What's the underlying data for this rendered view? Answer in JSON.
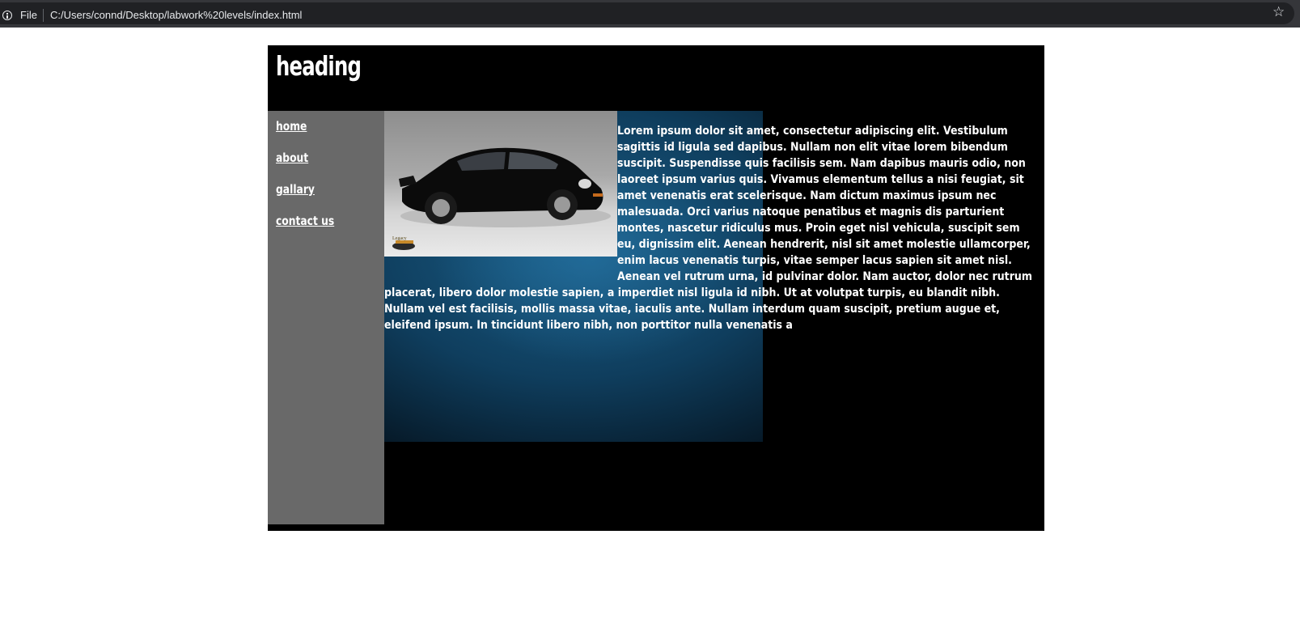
{
  "browser": {
    "file_label": "File",
    "url": "C:/Users/connd/Desktop/labwork%20levels/index.html"
  },
  "page": {
    "heading": "heading",
    "nav": [
      {
        "label": "home"
      },
      {
        "label": "about"
      },
      {
        "label": "gallary"
      },
      {
        "label": "contact us"
      }
    ],
    "car_logo_text": "Legacy",
    "body_text": "Lorem ipsum dolor sit amet, consectetur adipiscing elit. Vestibulum sagittis id ligula sed dapibus. Nullam non elit vitae lorem bibendum suscipit. Suspendisse quis facilisis sem. Nam dapibus mauris odio, non laoreet ipsum varius quis. Vivamus elementum tellus a nisi feugiat, sit amet venenatis erat scelerisque. Nam dictum maximus ipsum nec malesuada. Orci varius natoque penatibus et magnis dis parturient montes, nascetur ridiculus mus. Proin eget nisl vehicula, suscipit sem eu, dignissim elit. Aenean hendrerit, nisl sit amet molestie ullamcorper, enim lacus venenatis turpis, vitae semper lacus sapien sit amet nisl. Aenean vel rutrum urna, id pulvinar dolor. Nam auctor, dolor nec rutrum placerat, libero dolor molestie sapien, a imperdiet nisl ligula id nibh. Ut at volutpat turpis, eu blandit nibh. Nullam vel est facilisis, mollis massa vitae, iaculis ante. Nullam interdum quam suscipit, pretium augue et, eleifend ipsum. In tincidunt libero nibh, non porttitor nulla venenatis a"
  },
  "icons": {
    "info": "info-icon",
    "star": "star-icon"
  },
  "colors": {
    "page_bg": "#000000",
    "sidebar_bg": "#696969",
    "text": "#ffffff"
  }
}
